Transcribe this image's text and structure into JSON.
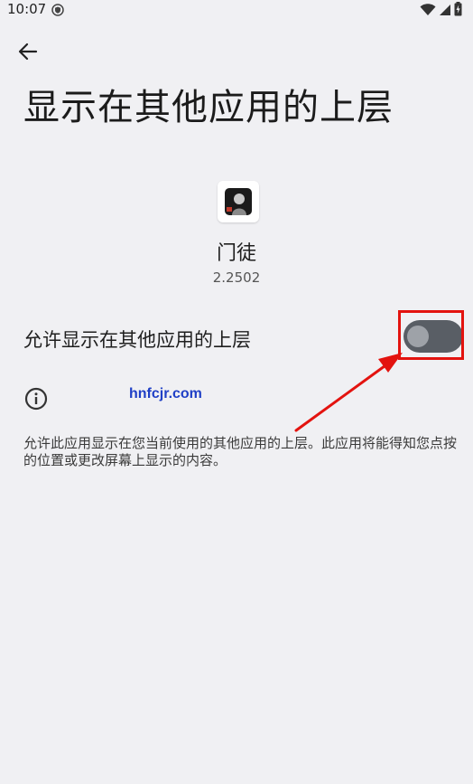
{
  "status_bar": {
    "time": "10:07",
    "icons": [
      "shield-icon",
      "wifi-icon",
      "signal-icon",
      "battery-charging-icon"
    ]
  },
  "navigation": {
    "back_icon": "arrow-back-icon"
  },
  "page": {
    "title": "显示在其他应用的上层"
  },
  "app": {
    "name": "门徒",
    "version": "2.2502"
  },
  "permission": {
    "label": "允许显示在其他应用的上层",
    "enabled": false
  },
  "info": {
    "icon": "info-icon",
    "watermark": "hnfcjr.com",
    "description": "允许此应用显示在您当前使用的其他应用的上层。此应用将能得知您点按的位置或更改屏幕上显示的内容。"
  },
  "annotation": {
    "highlight_color": "#e3130f"
  },
  "colors": {
    "background": "#f0f0f3",
    "toggle_track_off": "#595e65",
    "toggle_thumb_off": "#9ea2a8",
    "watermark": "#1f3fc6"
  }
}
